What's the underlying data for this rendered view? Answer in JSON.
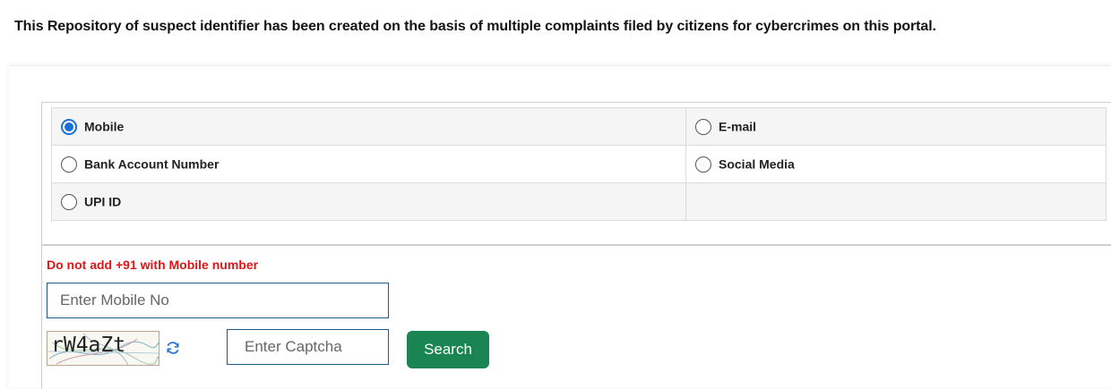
{
  "intro_text": "This Repository of suspect identifier has been created on the basis of multiple complaints filed by citizens for cybercrimes on this portal.",
  "options": {
    "mobile": {
      "label": "Mobile",
      "selected": true
    },
    "email": {
      "label": "E-mail",
      "selected": false
    },
    "bank_account": {
      "label": "Bank Account Number",
      "selected": false
    },
    "social_media": {
      "label": "Social Media",
      "selected": false
    },
    "upi_id": {
      "label": "UPI ID",
      "selected": false
    }
  },
  "warning_text": "Do not add +91 with Mobile number",
  "mobile_input": {
    "placeholder": "Enter Mobile No",
    "value": ""
  },
  "captcha": {
    "code": "rW4aZt",
    "icon": "refresh-icon"
  },
  "captcha_input": {
    "placeholder": "Enter Captcha",
    "value": ""
  },
  "search_button": {
    "label": "Search"
  },
  "colors": {
    "accent": "#1a6fd8",
    "warning": "#e01515",
    "button": "#1a8552"
  }
}
